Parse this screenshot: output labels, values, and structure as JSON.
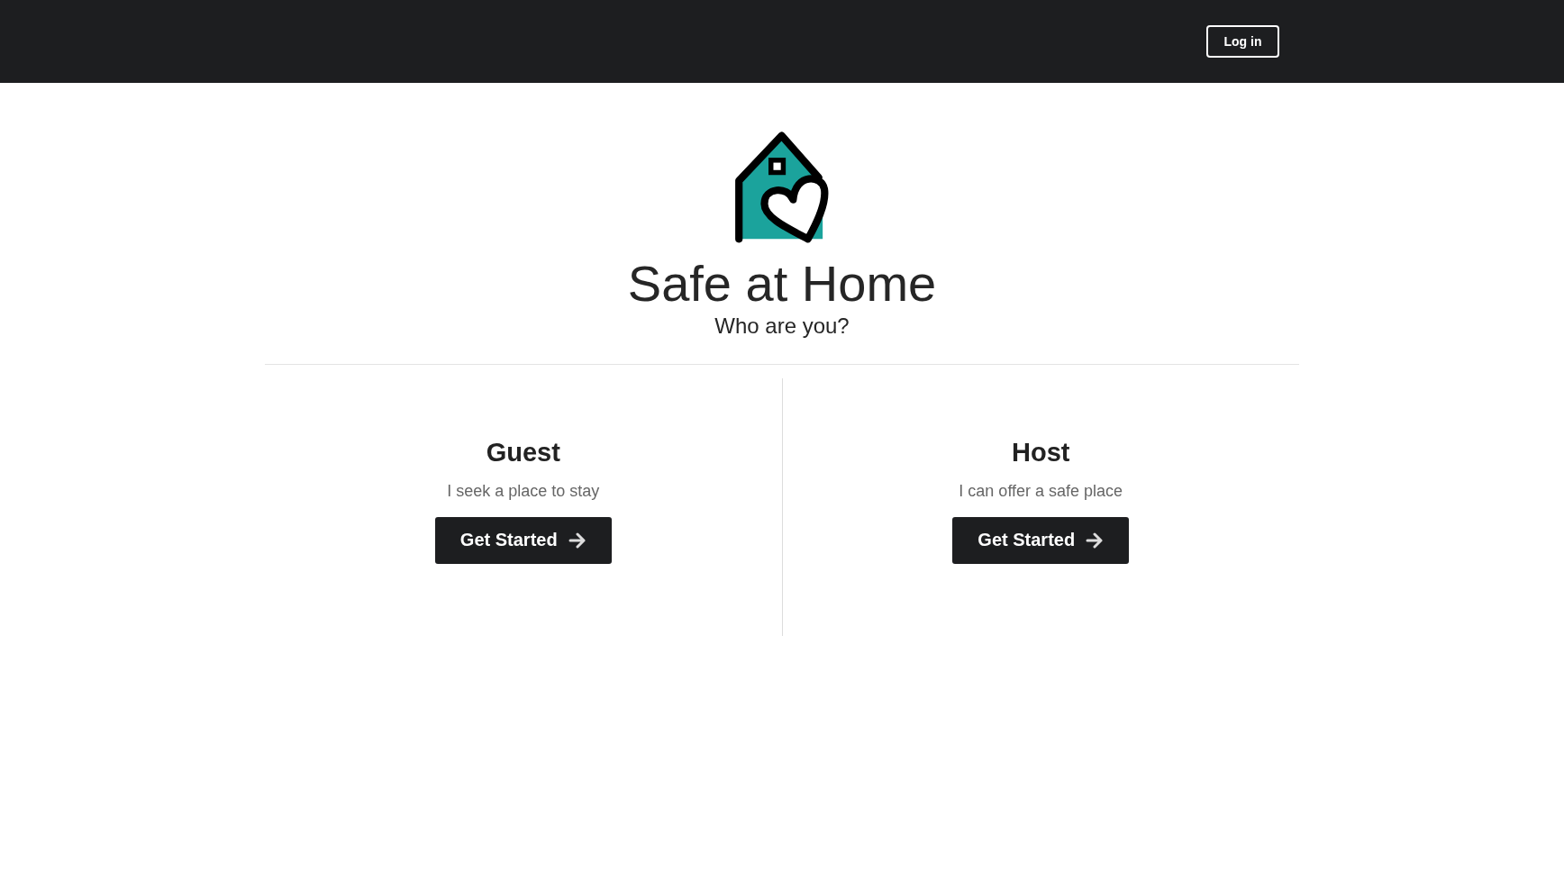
{
  "header": {
    "login_button": "Log in"
  },
  "brand": {
    "title": "Safe at Home",
    "subtitle": "Who are you?"
  },
  "roles": [
    {
      "title": "Guest",
      "description": "I seek a place to stay",
      "button": "Get Started"
    },
    {
      "title": "Host",
      "description": "I can offer a safe place",
      "button": "Get Started"
    }
  ]
}
